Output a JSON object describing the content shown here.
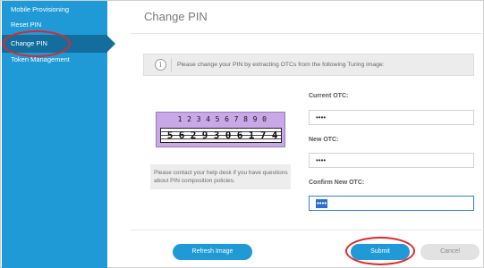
{
  "sidebar": {
    "items": [
      {
        "label": "Mobile Provisioning"
      },
      {
        "label": "Reset PIN"
      },
      {
        "label": "Change PIN"
      },
      {
        "label": "Token Management"
      }
    ],
    "active_index": 2
  },
  "page": {
    "title": "Change PIN"
  },
  "info": {
    "icon": "i",
    "text": "Please change your PIN by extracting OTCs from the following Turing image:"
  },
  "turing": {
    "top_digits": [
      "1",
      "2",
      "3",
      "4",
      "5",
      "6",
      "7",
      "8",
      "9",
      "0"
    ],
    "code_digits": [
      "5",
      "6",
      "2",
      "9",
      "3",
      "0",
      "6",
      "1",
      "7",
      "4"
    ]
  },
  "help": {
    "text": "Please contact your help desk if you have questions about PIN composition policies."
  },
  "form": {
    "current_otc": {
      "label": "Current OTC:",
      "value": "••••"
    },
    "new_otc": {
      "label": "New OTC:",
      "value": "••••"
    },
    "confirm_otc": {
      "label": "Confirm New OTC:",
      "value": "••••"
    }
  },
  "buttons": {
    "refresh": "Refresh Image",
    "submit": "Submit",
    "cancel": "Cancel"
  },
  "colors": {
    "sidebar": "#1f9ad7",
    "sidebar_active": "#146e9d",
    "annotation": "#e0262b",
    "turing_bg": "#c9a8e8"
  }
}
